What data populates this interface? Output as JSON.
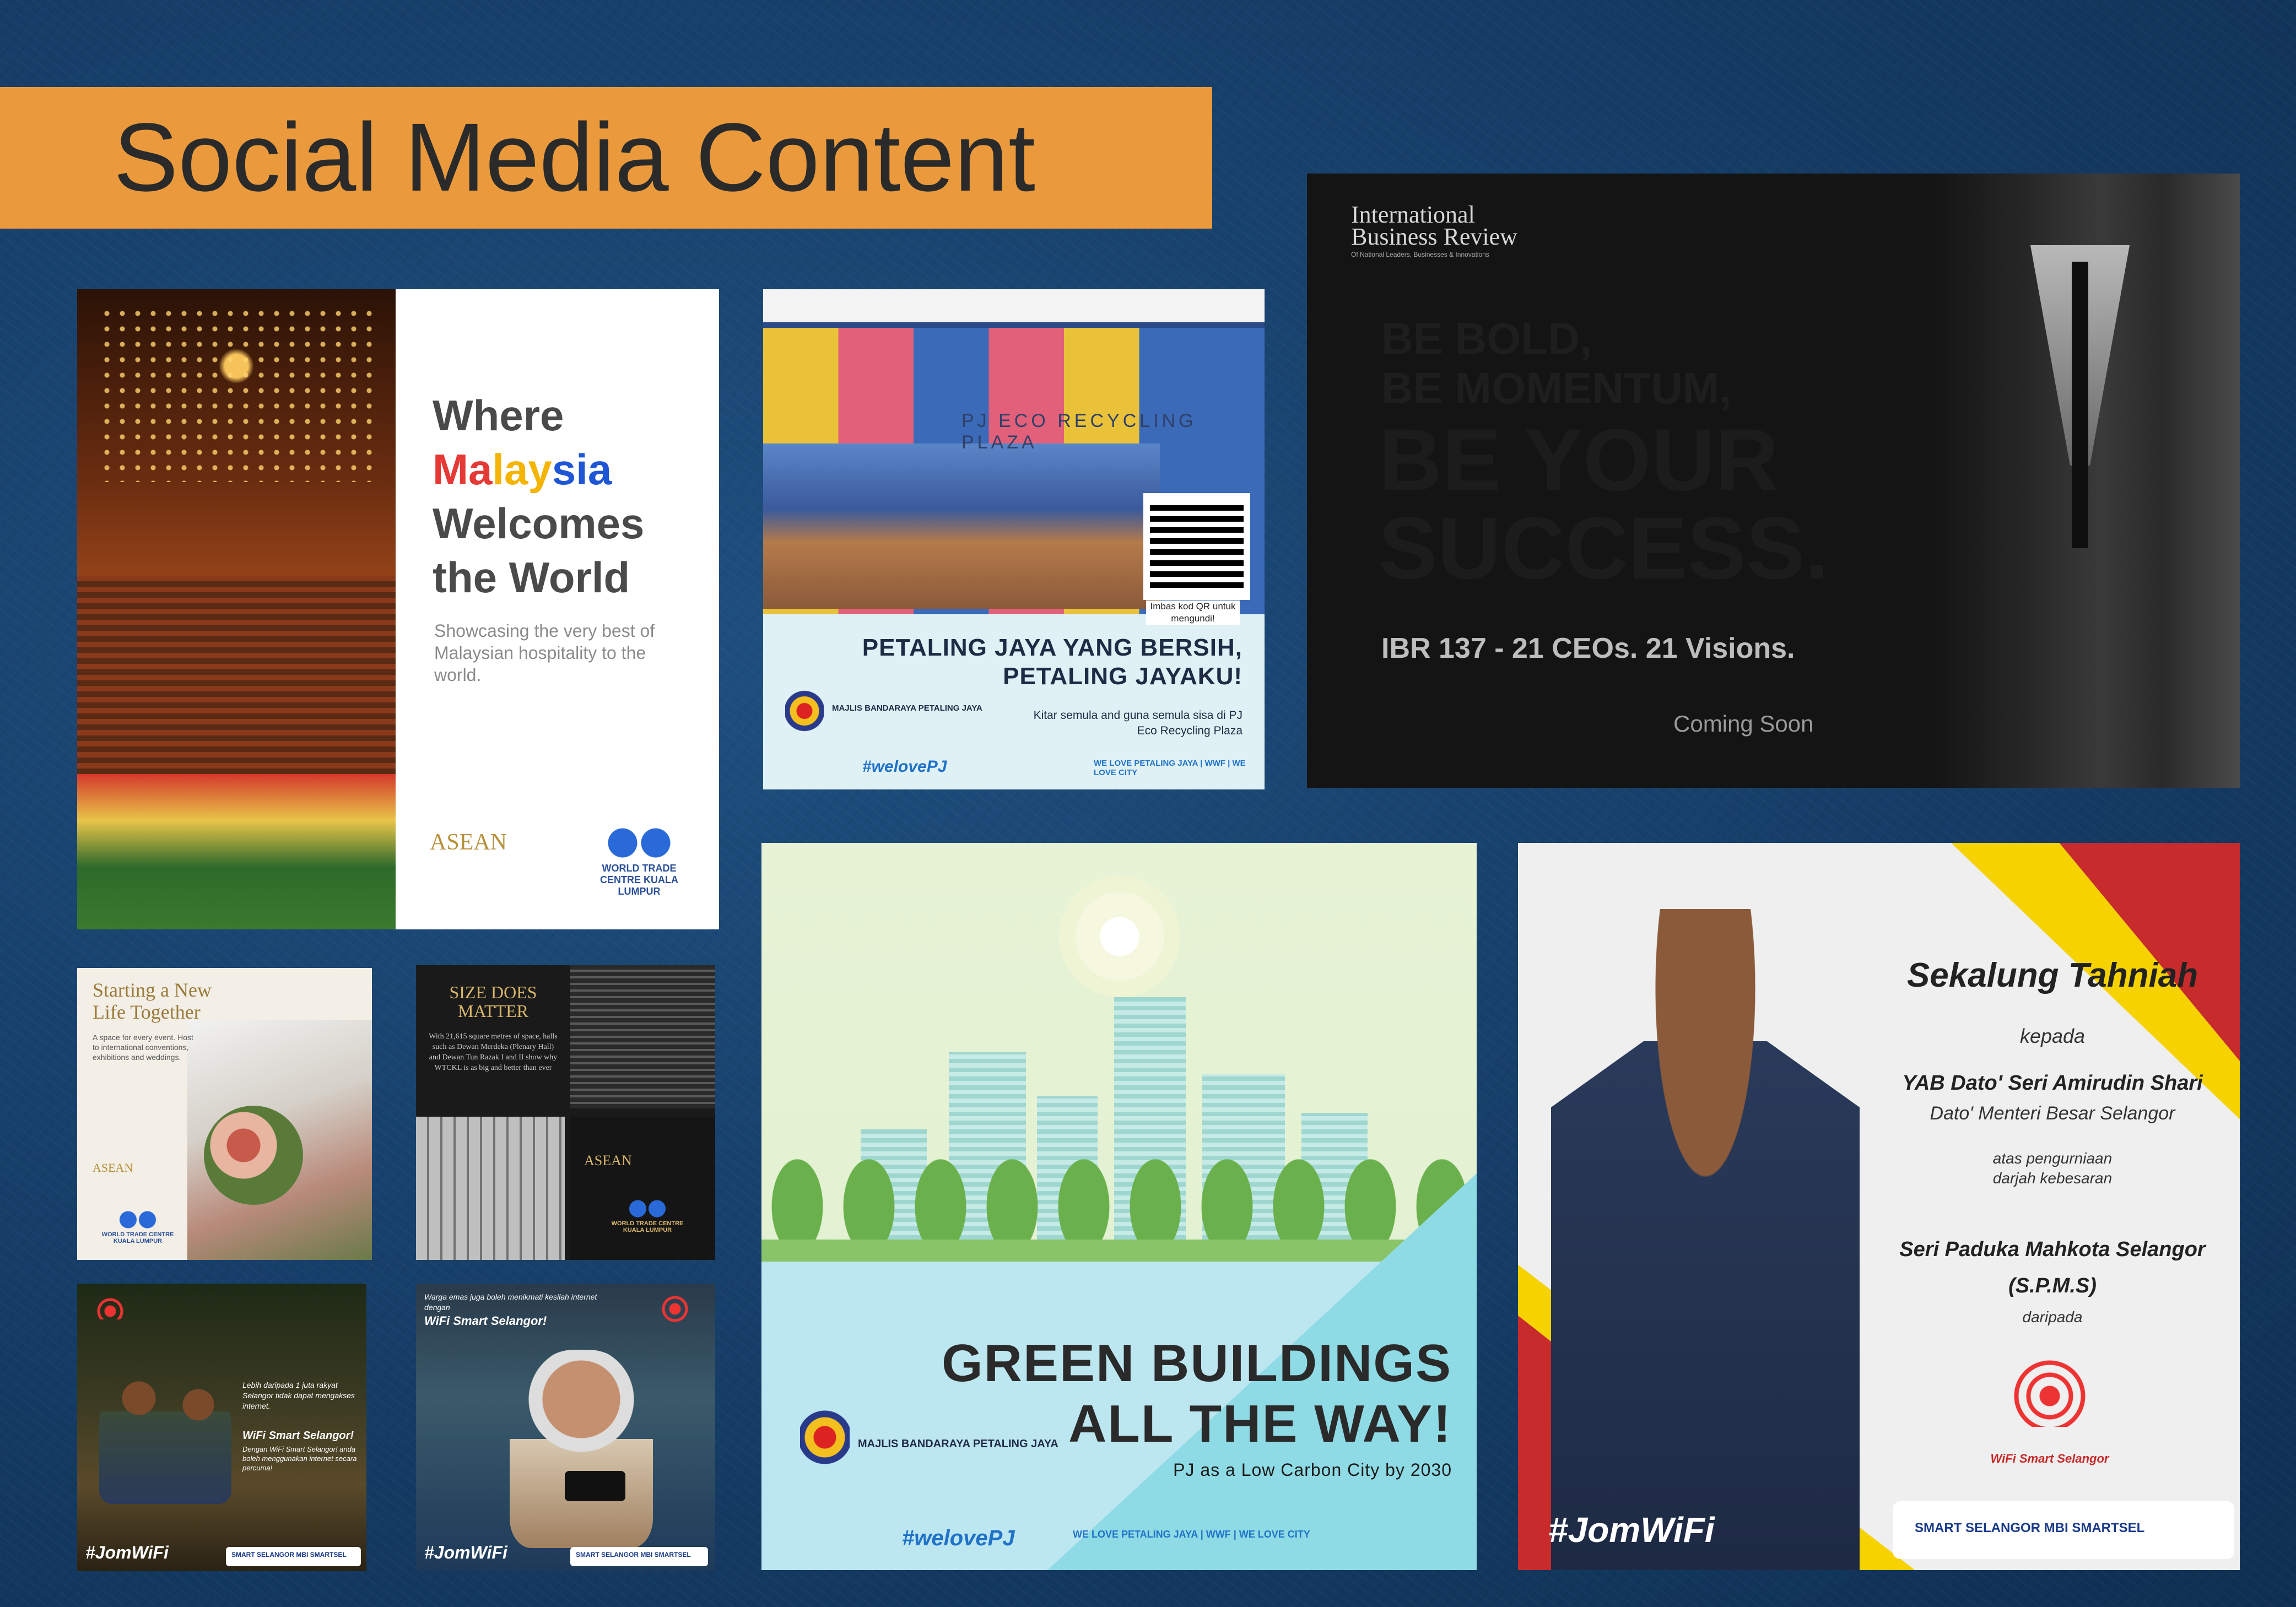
{
  "page": {
    "title": "Social Media Content"
  },
  "wtc_card": {
    "headline_1": "Where",
    "headline_malaysia": [
      "Ma",
      "lay",
      "sia"
    ],
    "headline_3": "Welcomes",
    "headline_4": "the World",
    "subtitle": "Showcasing the very best of Malaysian hospitality to the world.",
    "logo_asean": "ASEAN",
    "logo_wtc": "WORLD TRADE CENTRE KUALA LUMPUR",
    "colors": {
      "ma": "#e53935",
      "lay": "#f4b400",
      "sia": "#1e56d6"
    }
  },
  "pj_eco_card": {
    "sign": "PJ ECO RECYCLING PLAZA",
    "qr_caption": "Imbas kod QR untuk mengundi!",
    "headline_1": "PETALING JAYA YANG BERSIH,",
    "headline_2": "PETALING JAYAKU!",
    "subtitle": "Kitar semula and guna semula sisa di PJ Eco Recycling Plaza",
    "org": "MAJLIS BANDARAYA PETALING JAYA",
    "hashtag": "#welovePJ",
    "partner_logos": "WE LOVE PETALING JAYA | WWF | WE LOVE CITY"
  },
  "ibr_card": {
    "logo_1": "International",
    "logo_2": "Business Review",
    "logo_small": "Of National Leaders, Businesses & Innovations",
    "line_1": "BE BOLD,",
    "line_2": "BE MOMENTUM,",
    "line_3": "BE YOUR",
    "line_4": "SUCCESS.",
    "tagline": "IBR 137 - 21 CEOs. 21 Visions.",
    "coming_soon": "Coming Soon"
  },
  "new_life_card": {
    "headline_1": "Starting a New",
    "headline_2": "Life Together",
    "subtitle": "A space for every event. Host to international conventions, exhibitions and weddings.",
    "logo_asean": "ASEAN",
    "logo_wtc": "WORLD TRADE CENTRE KUALA LUMPUR"
  },
  "size_card": {
    "headline_1": "SIZE DOES",
    "headline_2": "MATTER",
    "subtitle": "With 21,615 square metres of space, halls such as Dewan Merdeka (Plenary Hall) and Dewan Tun Razak I and II show why WTCKL is as big and better than ever",
    "logo_asean": "ASEAN",
    "logo_wtc": "WORLD TRADE CENTRE KUALA LUMPUR"
  },
  "wifi_boys_card": {
    "text_1": "Lebih daripada 1 juta rakyat Selangor tidak dapat mengakses internet.",
    "wifi_label": "WiFi Smart Selangor!",
    "text_2": "Dengan WiFi Smart Selangor! anda boleh menggunakan internet secara percuma!",
    "hashtag": "#JomWiFi",
    "logos": "SMART SELANGOR  MBI  SMARTSEL"
  },
  "wifi_lady_card": {
    "text_1": "Warga emas juga boleh menikmati kesilah internet dengan",
    "wifi_label": "WiFi Smart Selangor!",
    "hashtag": "#JomWiFi",
    "logos": "SMART SELANGOR  MBI  SMARTSEL"
  },
  "green_card": {
    "headline_1": "GREEN BUILDINGS",
    "headline_2": "ALL THE WAY!",
    "subtitle": "PJ as a Low Carbon City by 2030",
    "org": "MAJLIS BANDARAYA PETALING JAYA",
    "hashtag": "#welovePJ",
    "partner_logos": "WE LOVE PETALING JAYA | WWF | WE LOVE CITY"
  },
  "tahniah_card": {
    "headline": "Sekalung Tahniah",
    "kepada": "kepada",
    "name": "YAB Dato' Seri Amirudin Shari",
    "title": "Dato' Menteri Besar Selangor",
    "atas_1": "atas pengurniaan",
    "atas_2": "darjah kebesaran",
    "award_1": "Seri Paduka Mahkota Selangor",
    "award_2": "(S.P.M.S)",
    "daripada": "daripada",
    "wifi_brand": "WiFi Smart Selangor",
    "hashtag": "#JomWiFi",
    "logos": "SMART SELANGOR   MBI   SMARTSEL"
  }
}
